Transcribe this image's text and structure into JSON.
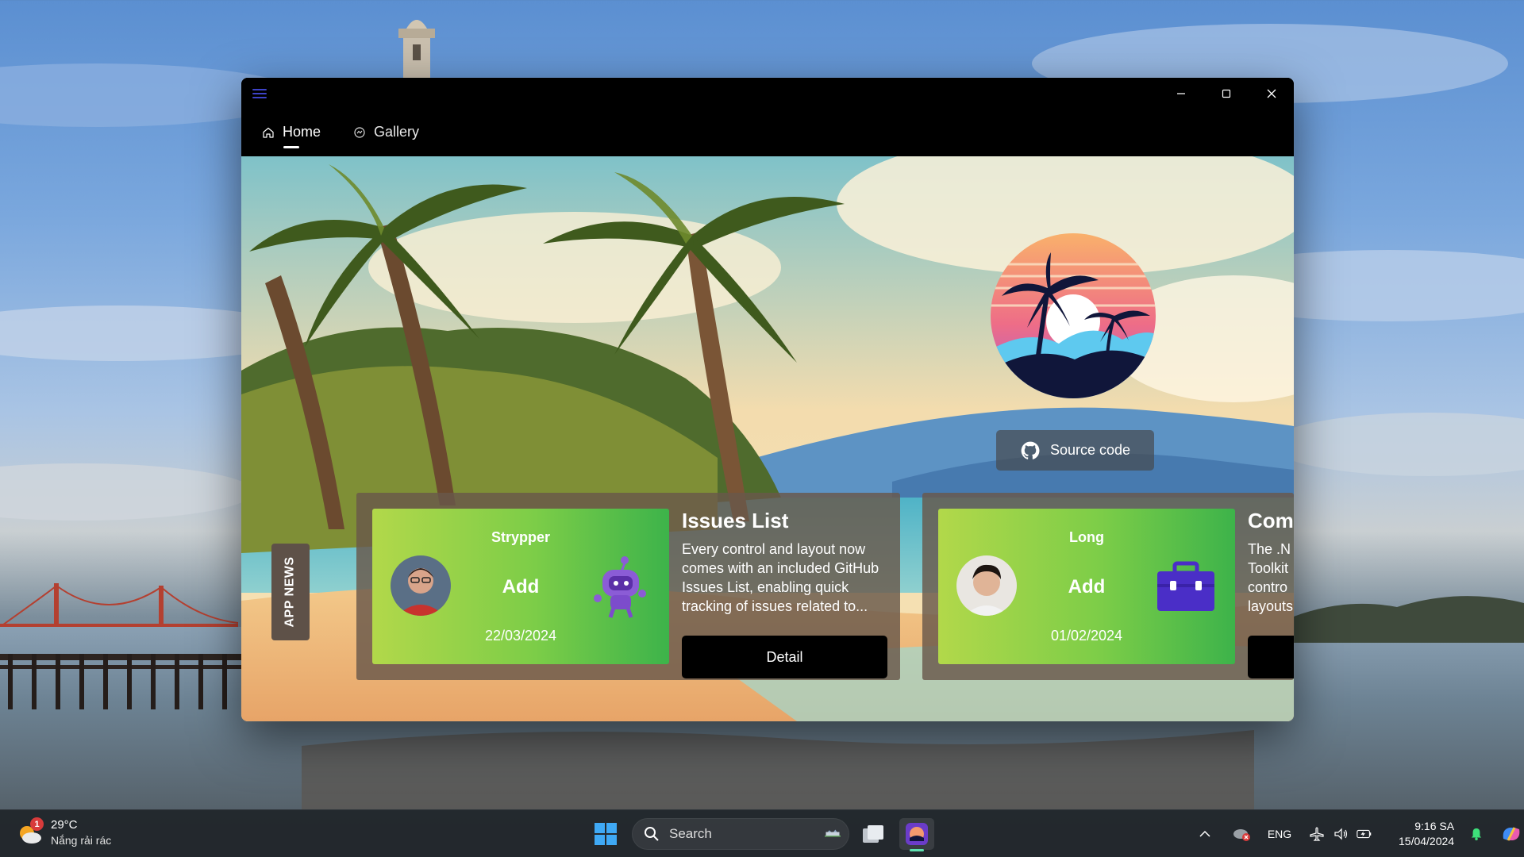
{
  "window": {
    "controls": {
      "minimize_icon": "minimize-icon",
      "maximize_icon": "maximize-icon",
      "close_icon": "close-icon"
    }
  },
  "nav": {
    "items": [
      {
        "label": "Home",
        "icon": "home-icon",
        "selected": true
      },
      {
        "label": "Gallery",
        "icon": "gallery-icon",
        "selected": false
      }
    ]
  },
  "hero": {
    "source_button": {
      "label": "Source code",
      "icon": "github-icon"
    }
  },
  "app_news": {
    "tab_label": "APP NEWS",
    "items": [
      {
        "author": "Strypper",
        "action": "Add",
        "date": "22/03/2024",
        "title": "Issues List",
        "description": "Every control and layout now comes with an included GitHub Issues List, enabling quick tracking of issues related to...",
        "button": "Detail"
      },
      {
        "author": "Long",
        "action": "Add",
        "date": "01/02/2024",
        "title": "Com",
        "description_lines": [
          "The .N",
          "Toolkit",
          "contro",
          "layouts"
        ],
        "button": ""
      }
    ]
  },
  "taskbar": {
    "weather": {
      "temp": "29°C",
      "desc": "Nắng rải rác",
      "badge": "1"
    },
    "search_placeholder": "Search",
    "tray": {
      "language": "ENG"
    },
    "clock": {
      "time": "9:16 SA",
      "date": "15/04/2024"
    }
  },
  "colors": {
    "accent": "#3d43c8",
    "card_gradient_start": "#b2d84a",
    "card_gradient_end": "#3db34a",
    "taskbar_bg": "#202428"
  }
}
